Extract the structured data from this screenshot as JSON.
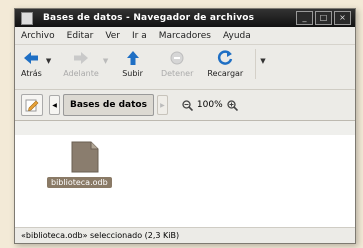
{
  "window": {
    "title": "Bases de datos - Navegador de archivos",
    "controls": [
      "_",
      "□",
      "×"
    ]
  },
  "menu": [
    "Archivo",
    "Editar",
    "Ver",
    "Ir a",
    "Marcadores",
    "Ayuda"
  ],
  "toolbar": {
    "back": "Atrás",
    "forward": "Adelante",
    "up": "Subir",
    "stop": "Detener",
    "reload": "Recargar"
  },
  "location": {
    "path": "Bases de datos",
    "zoom": "100%"
  },
  "files": [
    {
      "name": "biblioteca.odb",
      "selected": true
    }
  ],
  "status": "«biblioteca.odb» seleccionado (2,3 KiB)",
  "colors": {
    "accent": "#1f6fc4",
    "selection": "#8a7a66"
  }
}
